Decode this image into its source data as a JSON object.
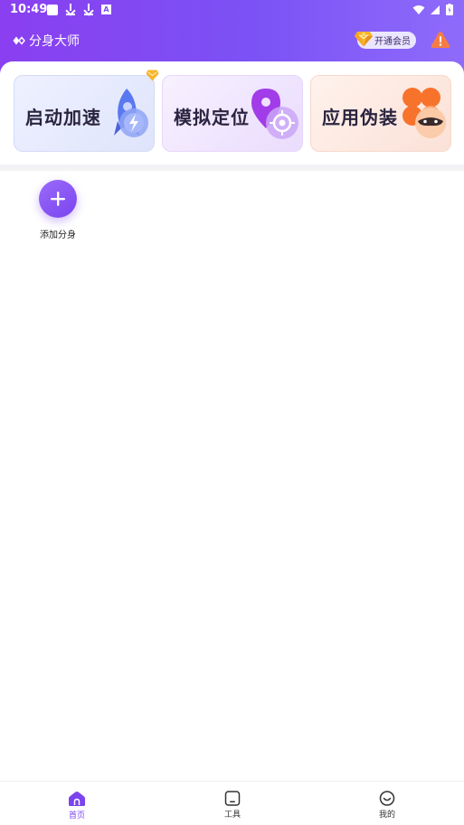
{
  "status_bar": {
    "time": "10:49",
    "icons": [
      "notification-square-icon",
      "download-icon",
      "download-icon",
      "a-badge-icon",
      "wifi-icon",
      "signal-icon",
      "battery-charging-icon"
    ]
  },
  "header": {
    "app_title": "分身大师",
    "vip_button_label": "开通会员",
    "icons": [
      "diamond-logo-icon",
      "vip-diamond-icon",
      "warning-icon"
    ]
  },
  "features": [
    {
      "label": "启动加速",
      "icon": "rocket-bolt-icon",
      "badge": "vip-diamond-icon"
    },
    {
      "label": "模拟定位",
      "icon": "location-target-icon"
    },
    {
      "label": "应用伪装",
      "icon": "clover-mask-icon"
    }
  ],
  "main": {
    "add_label": "添加分身",
    "add_icon": "plus-icon"
  },
  "bottom_nav": {
    "items": [
      {
        "label": "首页",
        "icon": "home-icon",
        "active": true
      },
      {
        "label": "工具",
        "icon": "tools-icon",
        "active": false
      },
      {
        "label": "我的",
        "icon": "smile-icon",
        "active": false
      }
    ]
  },
  "colors": {
    "brand_primary": "#7b44ee",
    "header_gradient_start": "#8a3ff0",
    "header_gradient_end": "#8f6bfb",
    "warning_orange": "#f57d45",
    "vip_gold": "#f5a623"
  }
}
